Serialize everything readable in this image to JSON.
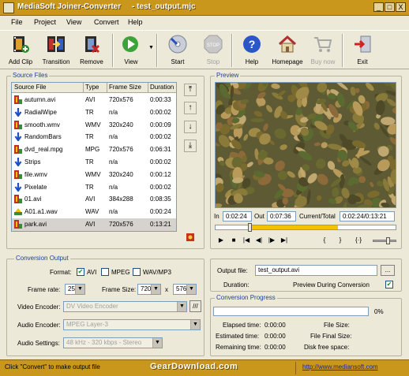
{
  "window": {
    "title": "MediaSoft Joiner-Converter",
    "document": "- test_output.mjc",
    "controls": [
      "_",
      "□",
      "X"
    ]
  },
  "menu": [
    "File",
    "Project",
    "View",
    "Convert",
    "Help"
  ],
  "toolbar": {
    "add_clip": "Add Clip",
    "transition": "Transition",
    "remove": "Remove",
    "view": "View",
    "start": "Start",
    "stop": "Stop",
    "help": "Help",
    "homepage": "Homepage",
    "buy_now": "Buy now",
    "exit": "Exit"
  },
  "source_files": {
    "title": "Source Files",
    "columns": [
      "Source File",
      "Type",
      "Frame Size",
      "Duration"
    ],
    "rows": [
      {
        "name": "autumn.avi",
        "type": "AVI",
        "size": "720x576",
        "dur": "0:00:33",
        "kind": "video"
      },
      {
        "name": "RadialWipe",
        "type": "TR",
        "size": "n/a",
        "dur": "0:00:02",
        "kind": "transition"
      },
      {
        "name": "smooth.wmv",
        "type": "WMV",
        "size": "320x240",
        "dur": "0:00:09",
        "kind": "video"
      },
      {
        "name": "RandomBars",
        "type": "TR",
        "size": "n/a",
        "dur": "0:00:02",
        "kind": "transition"
      },
      {
        "name": "dvd_real.mpg",
        "type": "MPG",
        "size": "720x576",
        "dur": "0:06:31",
        "kind": "video"
      },
      {
        "name": "Strips",
        "type": "TR",
        "size": "n/a",
        "dur": "0:00:02",
        "kind": "transition"
      },
      {
        "name": "file.wmv",
        "type": "WMV",
        "size": "320x240",
        "dur": "0:00:12",
        "kind": "video"
      },
      {
        "name": "Pixelate",
        "type": "TR",
        "size": "n/a",
        "dur": "0:00:02",
        "kind": "transition"
      },
      {
        "name": "01.avi",
        "type": "AVI",
        "size": "384x288",
        "dur": "0:08:35",
        "kind": "video"
      },
      {
        "name": "A01.a1.wav",
        "type": "WAV",
        "size": "n/a",
        "dur": "0:00:24",
        "kind": "audio"
      },
      {
        "name": "park.avi",
        "type": "AVI",
        "size": "720x576",
        "dur": "0:13:21",
        "kind": "video"
      }
    ],
    "selected_index": 10
  },
  "preview": {
    "title": "Preview",
    "in_label": "In",
    "in_value": "0:02:24",
    "out_label": "Out",
    "out_value": "0:07:36",
    "current_label": "Current/Total",
    "current_value": "0:02:24/0:13:21",
    "seek_position": 0.18,
    "volume_level": 0.6,
    "controls": [
      "▶",
      "■",
      "|◀",
      "◀|",
      "|▶",
      "▶|",
      "{",
      "}",
      "{·}"
    ]
  },
  "conversion_output": {
    "title": "Conversion Output",
    "format_label": "Format:",
    "formats": [
      {
        "label": "AVI",
        "checked": true
      },
      {
        "label": "MPEG",
        "checked": false
      },
      {
        "label": "WAV/MP3",
        "checked": false
      }
    ],
    "frame_rate_label": "Frame rate:",
    "frame_rate": "25",
    "frame_size_label": "Frame Size:",
    "frame_w": "720",
    "frame_x": "x",
    "frame_h": "576",
    "video_encoder_label": "Video Encoder:",
    "video_encoder": "DV Video Encoder",
    "audio_encoder_label": "Audio Encoder:",
    "audio_encoder": "MPEG Layer-3",
    "audio_settings_label": "Audio Settings:",
    "audio_settings": "48 kHz -  320 kbps - Stereo"
  },
  "output_file": {
    "label": "Output file:",
    "value": "test_output.avi",
    "browse": "...",
    "duration_label": "Duration:",
    "preview_during": "Preview During Conversion",
    "preview_checked": true
  },
  "progress": {
    "title": "Conversion Progress",
    "percent_text": "0%",
    "percent": 0,
    "elapsed_label": "Elapsed time:",
    "elapsed": "0:00:00",
    "estimated_label": "Estimated time:",
    "estimated": "0:00:00",
    "remaining_label": "Remaining time:",
    "remaining": "0:00:00",
    "file_size_label": "File Size:",
    "final_size_label": "File Final Size:",
    "disk_free_label": "Disk free space:"
  },
  "status": {
    "hint": "Click \"Convert\" to make output file",
    "watermark": "GearDownload.com",
    "url": "http://www.mediansoft.com"
  },
  "colors": {
    "title_bar": "#c8971b",
    "group_title": "#1f3f9a",
    "window_bg": "#ece9d8"
  }
}
